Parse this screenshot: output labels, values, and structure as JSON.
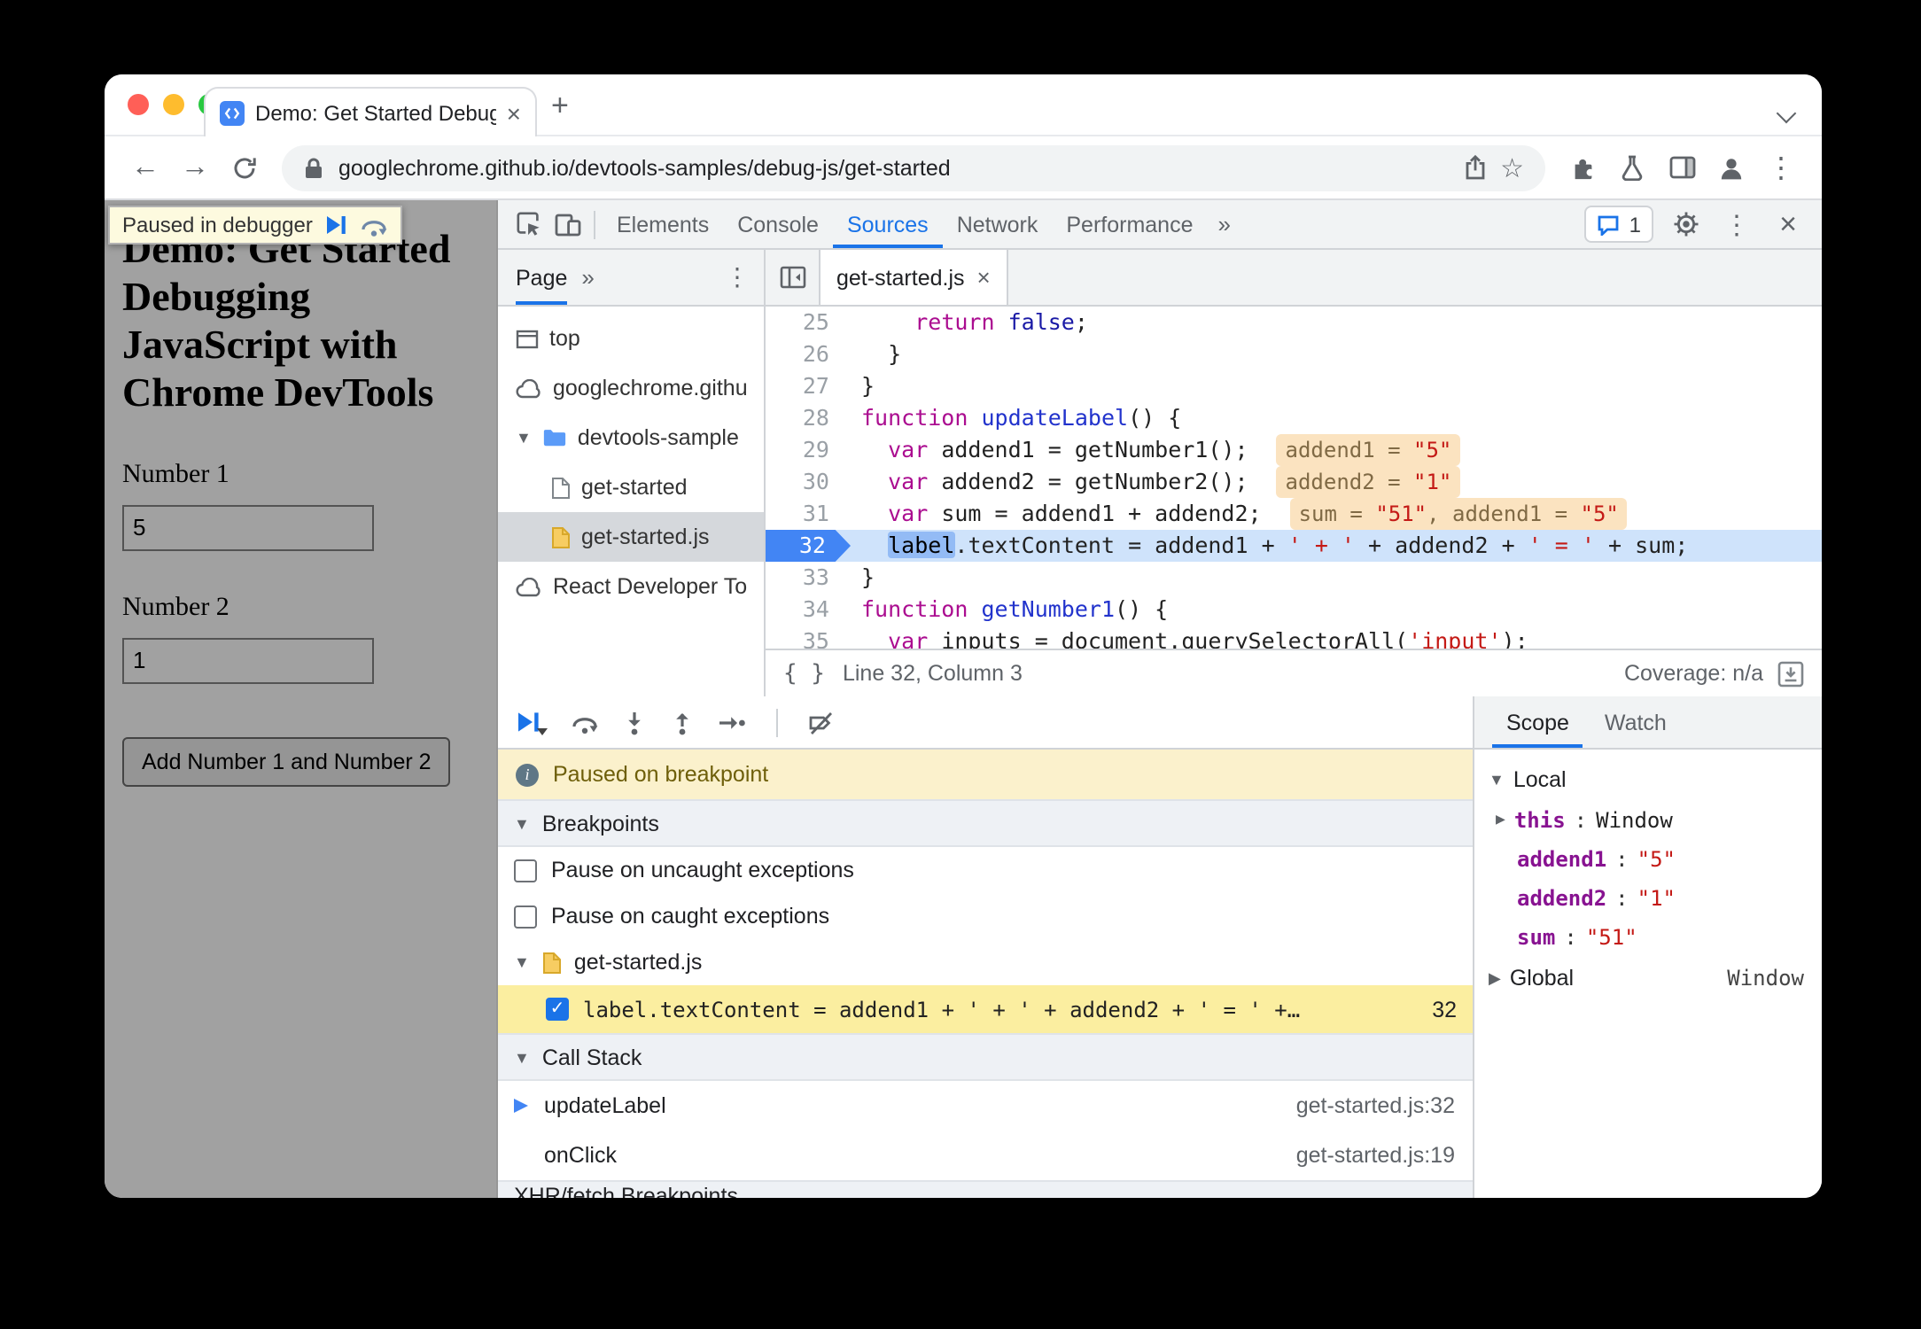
{
  "browser": {
    "tab_title": "Demo: Get Started Debugging",
    "url": "googlechrome.github.io/devtools-samples/debug-js/get-started",
    "glyphs": {
      "back": "←",
      "forward": "→",
      "star": "☆",
      "menu": "⋮",
      "close": "×",
      "new_tab": "+",
      "more": "»",
      "braces": "{ }",
      "check": "✓",
      "tri_down": "▼",
      "tri_right": "▶"
    }
  },
  "page": {
    "paused_tooltip": "Paused in debugger",
    "heading": "Demo: Get Started Debugging JavaScript with Chrome DevTools",
    "number1_label": "Number 1",
    "number1_value": "5",
    "number2_label": "Number 2",
    "number2_value": "1",
    "add_button": "Add Number 1 and Number 2"
  },
  "devtools": {
    "tabs": [
      "Elements",
      "Console",
      "Sources",
      "Network",
      "Performance"
    ],
    "active_tab": "Sources",
    "issues_count": "1",
    "navigator": {
      "tab": "Page",
      "items": [
        {
          "label": "top",
          "icon": "frame-icon"
        },
        {
          "label": "googlechrome.githu",
          "icon": "cloud-icon"
        },
        {
          "label": "devtools-sample",
          "icon": "folder-icon",
          "expanded": true
        },
        {
          "label": "get-started",
          "icon": "file-icon",
          "indent": 1
        },
        {
          "label": "get-started.js",
          "icon": "js-file-icon",
          "indent": 1,
          "selected": true
        },
        {
          "label": "React Developer To",
          "icon": "cloud-icon"
        }
      ]
    },
    "editor": {
      "tab": "get-started.js",
      "status": {
        "line_col": "Line 32, Column 3",
        "coverage": "Coverage: n/a"
      },
      "lines": [
        {
          "n": "25",
          "tokens": [
            {
              "t": "    "
            },
            {
              "t": "return",
              "c": "kw"
            },
            {
              "t": " "
            },
            {
              "t": "false",
              "c": "atom"
            },
            {
              "t": ";"
            }
          ]
        },
        {
          "n": "26",
          "tokens": [
            {
              "t": "  }"
            }
          ]
        },
        {
          "n": "27",
          "tokens": [
            {
              "t": "}"
            }
          ]
        },
        {
          "n": "28",
          "tokens": [
            {
              "t": "function",
              "c": "kw"
            },
            {
              "t": " "
            },
            {
              "t": "updateLabel",
              "c": "def"
            },
            {
              "t": "() {"
            }
          ]
        },
        {
          "n": "29",
          "tokens": [
            {
              "t": "  "
            },
            {
              "t": "var",
              "c": "kw"
            },
            {
              "t": " addend1 = getNumber1();"
            }
          ],
          "badge": [
            {
              "t": "addend1 = "
            },
            {
              "t": "\"5\"",
              "c": "str"
            }
          ]
        },
        {
          "n": "30",
          "tokens": [
            {
              "t": "  "
            },
            {
              "t": "var",
              "c": "kw"
            },
            {
              "t": " addend2 = getNumber2();"
            }
          ],
          "badge": [
            {
              "t": "addend2 = "
            },
            {
              "t": "\"1\"",
              "c": "str"
            }
          ]
        },
        {
          "n": "31",
          "tokens": [
            {
              "t": "  "
            },
            {
              "t": "var",
              "c": "kw"
            },
            {
              "t": " sum = addend1 + addend2;"
            }
          ],
          "badge": [
            {
              "t": "sum = "
            },
            {
              "t": "\"51\"",
              "c": "str"
            },
            {
              "t": ", addend1 = "
            },
            {
              "t": "\"5\"",
              "c": "str"
            }
          ]
        },
        {
          "n": "32",
          "current": true,
          "tokens": [
            {
              "t": "  "
            },
            {
              "t": "label",
              "c": "sel"
            },
            {
              "t": ".textContent = addend1 + "
            },
            {
              "t": "' + '",
              "c": "str"
            },
            {
              "t": " + addend2 + "
            },
            {
              "t": "' = '",
              "c": "str"
            },
            {
              "t": " + sum;"
            }
          ]
        },
        {
          "n": "33",
          "tokens": [
            {
              "t": "}"
            }
          ]
        },
        {
          "n": "34",
          "tokens": [
            {
              "t": "function",
              "c": "kw"
            },
            {
              "t": " "
            },
            {
              "t": "getNumber1",
              "c": "def"
            },
            {
              "t": "() {"
            }
          ]
        },
        {
          "n": "35",
          "clipped": true,
          "tokens": [
            {
              "t": "  "
            },
            {
              "t": "var",
              "c": "kw"
            },
            {
              "t": " inputs = document.querySelectorAll("
            },
            {
              "t": "'input'",
              "c": "str"
            },
            {
              "t": ");"
            }
          ]
        }
      ]
    },
    "debugger": {
      "paused_message": "Paused on breakpoint",
      "breakpoints_header": "Breakpoints",
      "pause_uncaught": "Pause on uncaught exceptions",
      "pause_caught": "Pause on caught exceptions",
      "group": "get-started.js",
      "breakpoint_code": "label.textContent = addend1 + ' + ' + addend2 + ' = ' +…",
      "breakpoint_line": "32",
      "callstack_header": "Call Stack",
      "frames": [
        {
          "name": "updateLabel",
          "location": "get-started.js:32",
          "current": true
        },
        {
          "name": "onClick",
          "location": "get-started.js:19"
        }
      ],
      "clipped_section": "XHR/fetch Breakpoints"
    },
    "scope": {
      "tabs": [
        "Scope",
        "Watch"
      ],
      "active_tab": "Scope",
      "local_label": "Local",
      "entries": [
        {
          "name": "this",
          "value": "Window",
          "vtype": "obj",
          "expandable": true
        },
        {
          "name": "addend1",
          "value": "\"5\"",
          "vtype": "str"
        },
        {
          "name": "addend2",
          "value": "\"1\"",
          "vtype": "str"
        },
        {
          "name": "sum",
          "value": "\"51\"",
          "vtype": "str"
        }
      ],
      "global_label": "Global",
      "global_value": "Window"
    }
  }
}
